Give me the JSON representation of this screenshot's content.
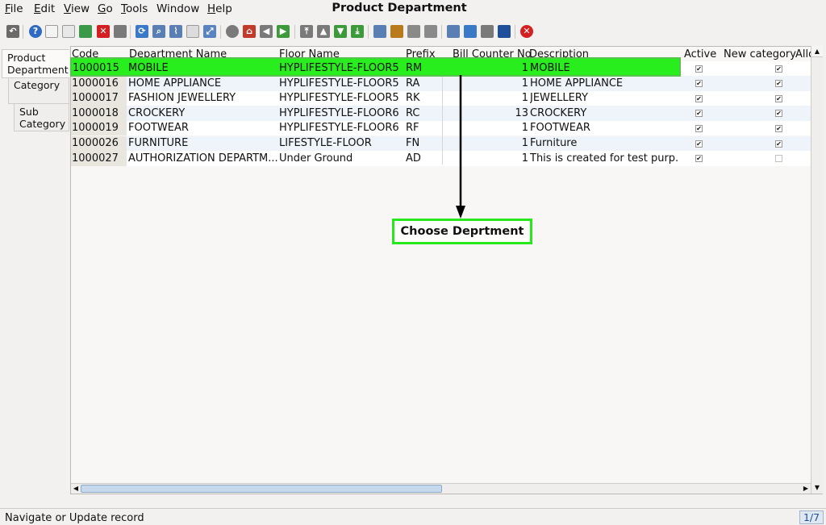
{
  "window": {
    "title": "Product Department"
  },
  "menu": [
    {
      "label": "File",
      "mnemonic": "F",
      "rest": "ile"
    },
    {
      "label": "Edit",
      "mnemonic": "E",
      "rest": "dit"
    },
    {
      "label": "View",
      "mnemonic": "V",
      "rest": "iew"
    },
    {
      "label": "Go",
      "mnemonic": "G",
      "rest": "o"
    },
    {
      "label": "Tools",
      "mnemonic": "T",
      "rest": "ools"
    },
    {
      "label": "Window",
      "mnemonic": "",
      "rest": "Window"
    },
    {
      "label": "Help",
      "mnemonic": "H",
      "rest": "elp"
    }
  ],
  "toolbar": {
    "icons": [
      "undo-icon",
      "help-icon",
      "new-record-icon",
      "copy-record-icon",
      "save-record-icon",
      "delete-icon",
      "grid-toggle-icon",
      "refresh-icon",
      "find-icon",
      "attachment-icon",
      "chat-icon",
      "zoom-fit-icon",
      "history-icon",
      "home-icon",
      "back-icon",
      "forward-icon",
      "first-record-icon",
      "previous-record-icon",
      "next-record-icon",
      "last-record-icon",
      "report-icon",
      "archive-icon",
      "print-icon",
      "print-preview-icon",
      "zoom-across-icon",
      "workflow-icon",
      "product-info-icon",
      "request-icon",
      "exit-icon"
    ]
  },
  "tabs": {
    "product_department": "Product Department",
    "category": "Category",
    "sub_category": "Sub Category"
  },
  "grid": {
    "columns": {
      "code": "Code",
      "department_name": "Department Name",
      "floor_name": "Floor Name",
      "prefix": "Prefix",
      "bill_counter_no": "Bill Counter No",
      "description": "Description",
      "active": "Active",
      "new_category": "New category",
      "allow": "Allo"
    },
    "rows": [
      {
        "code": "1000015",
        "department_name": "MOBILE",
        "floor_name": "HYPLIFESTYLE-FLOOR5",
        "prefix": "RM",
        "bill_counter_no": "1",
        "description": "MOBILE",
        "active": true,
        "new_category": true
      },
      {
        "code": "1000016",
        "department_name": "HOME APPLIANCE",
        "floor_name": "HYPLIFESTYLE-FLOOR5",
        "prefix": "RA",
        "bill_counter_no": "1",
        "description": "HOME APPLIANCE",
        "active": true,
        "new_category": true
      },
      {
        "code": "1000017",
        "department_name": "FASHION JEWELLERY",
        "floor_name": "HYPLIFESTYLE-FLOOR5",
        "prefix": "RK",
        "bill_counter_no": "1",
        "description": "JEWELLERY",
        "active": true,
        "new_category": true
      },
      {
        "code": "1000018",
        "department_name": "CROCKERY",
        "floor_name": "HYPLIFESTYLE-FLOOR6",
        "prefix": "RC",
        "bill_counter_no": "13",
        "description": "CROCKERY",
        "active": true,
        "new_category": true
      },
      {
        "code": "1000019",
        "department_name": "FOOTWEAR",
        "floor_name": "HYPLIFESTYLE-FLOOR6",
        "prefix": "RF",
        "bill_counter_no": "1",
        "description": "FOOTWEAR",
        "active": true,
        "new_category": true
      },
      {
        "code": "1000026",
        "department_name": "FURNITURE",
        "floor_name": "LIFESTYLE-FLOOR",
        "prefix": "FN",
        "bill_counter_no": "1",
        "description": "Furniture",
        "active": true,
        "new_category": true
      },
      {
        "code": "1000027",
        "department_name": "AUTHORIZATION DEPARTM...",
        "floor_name": "Under Ground",
        "prefix": "AD",
        "bill_counter_no": "1",
        "description": "This is created for test purp...",
        "active": true,
        "new_category": false
      }
    ]
  },
  "annotation": {
    "callout": "Choose Deprtment",
    "highlight_color": "#27ee1c"
  },
  "status": {
    "message": "Navigate or Update record",
    "record_count": "1/7"
  }
}
